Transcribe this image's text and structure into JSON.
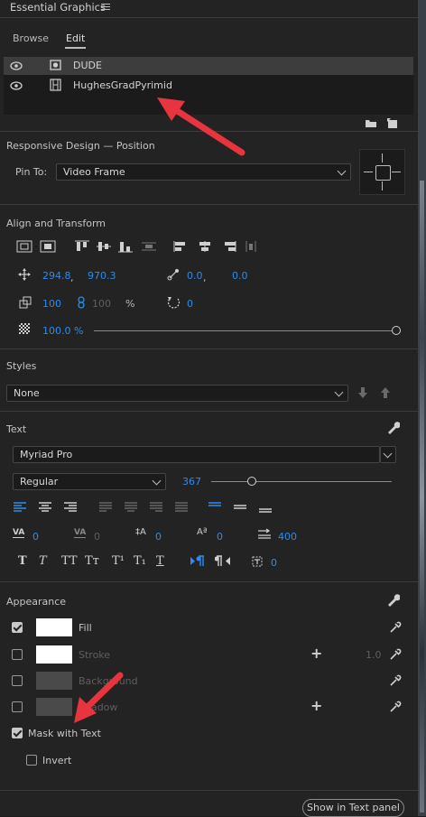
{
  "panel": {
    "title": "Essential Graphics",
    "menu_icon": "hamburger-icon"
  },
  "tabs": [
    {
      "label": "Browse",
      "active": false
    },
    {
      "label": "Edit",
      "active": true
    }
  ],
  "layers": [
    {
      "name": "DUDE",
      "icon": "shape-icon",
      "visible": true,
      "selected": true
    },
    {
      "name": "HughesGradPyrimid",
      "icon": "film-icon",
      "visible": true,
      "selected": false
    }
  ],
  "responsive": {
    "heading": "Responsive Design — Position",
    "pin_label": "Pin To:",
    "pin_value": "Video Frame"
  },
  "align": {
    "heading": "Align and Transform",
    "pos_x": "294.8",
    "pos_y": "970.3",
    "anchor_x": "0.0",
    "anchor_y": "0.0",
    "scale": "100",
    "scale_locked": "100",
    "scale_unit": "%",
    "rotation": "0",
    "opacity": "100.0 %",
    "sep": ","
  },
  "styles": {
    "heading": "Styles",
    "value": "None"
  },
  "text": {
    "heading": "Text",
    "font": "Myriad Pro",
    "style": "Regular",
    "size": "367",
    "kerning": "0",
    "tracking": "0",
    "leading": "0",
    "baseline": "0",
    "tab_width": "400",
    "tsume": "0",
    "type_buttons": [
      "T",
      "T",
      "TT",
      "Tт",
      "T¹",
      "T₁",
      "T"
    ]
  },
  "appearance": {
    "heading": "Appearance",
    "items": [
      {
        "label": "Fill",
        "checked": true,
        "swatch": "#ffffff"
      },
      {
        "label": "Stroke",
        "checked": false,
        "swatch": "#ffffff",
        "value": "1.0"
      },
      {
        "label": "Background",
        "checked": false,
        "swatch": "#4a4a4a"
      },
      {
        "label": "Shadow",
        "checked": false,
        "swatch": "#4a4a4a"
      }
    ],
    "mask_label": "Mask with Text",
    "mask_checked": true,
    "invert_label": "Invert",
    "invert_checked": false
  },
  "footer": {
    "button_label": "Show in Text panel"
  },
  "colors": {
    "accent": "#2d8ceb",
    "annotation_arrow": "#e8343e",
    "panel_bg": "#232323"
  }
}
